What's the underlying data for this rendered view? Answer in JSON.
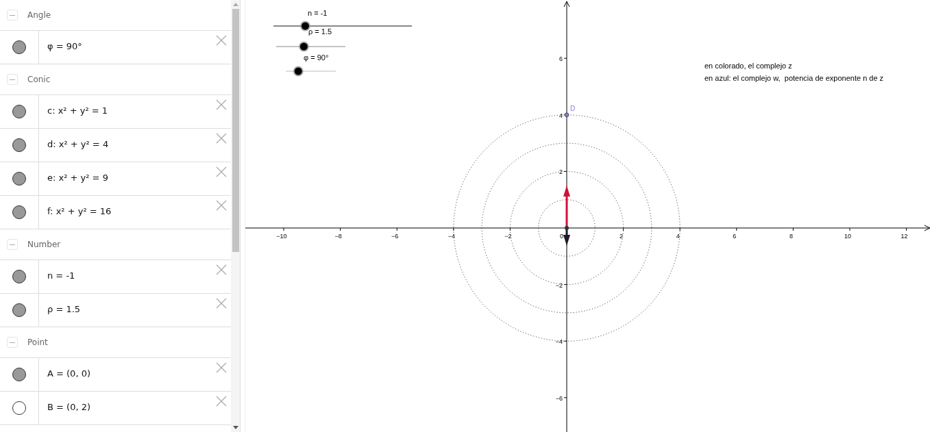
{
  "algebra": {
    "groups": [
      {
        "title": "Angle",
        "items": [
          {
            "text": "φ = 90°",
            "visible": true
          }
        ]
      },
      {
        "title": "Conic",
        "items": [
          {
            "text": "c: x² + y² = 1",
            "visible": true
          },
          {
            "text": "d: x² + y² = 4",
            "visible": true
          },
          {
            "text": "e: x² + y² = 9",
            "visible": true
          },
          {
            "text": "f: x² + y² = 16",
            "visible": true
          }
        ]
      },
      {
        "title": "Number",
        "items": [
          {
            "text": "n = -1",
            "visible": true
          },
          {
            "text": "ρ = 1.5",
            "visible": true
          }
        ]
      },
      {
        "title": "Point",
        "items": [
          {
            "text": "A = (0, 0)",
            "visible": true
          },
          {
            "text": "B = (0, 2)",
            "visible": false
          }
        ]
      }
    ]
  },
  "graphics": {
    "sliders": [
      {
        "label": "n = -1",
        "level": 0.23
      },
      {
        "label": "ρ = 1.5",
        "level": 0.4
      },
      {
        "label": "φ = 90°",
        "level": 0.25
      }
    ],
    "x_ticks": [
      "−10",
      "−8",
      "−6",
      "−4",
      "−2",
      "2",
      "4",
      "6",
      "8",
      "10",
      "12"
    ],
    "y_ticks": [
      "6",
      "4",
      "2",
      "−2",
      "−4",
      "−6"
    ],
    "origin_label": "0",
    "point_label": "D",
    "notes": [
      "en colorado, el complejo z",
      "en azul: el complejo w,  potencia de exponente n de z"
    ]
  }
}
